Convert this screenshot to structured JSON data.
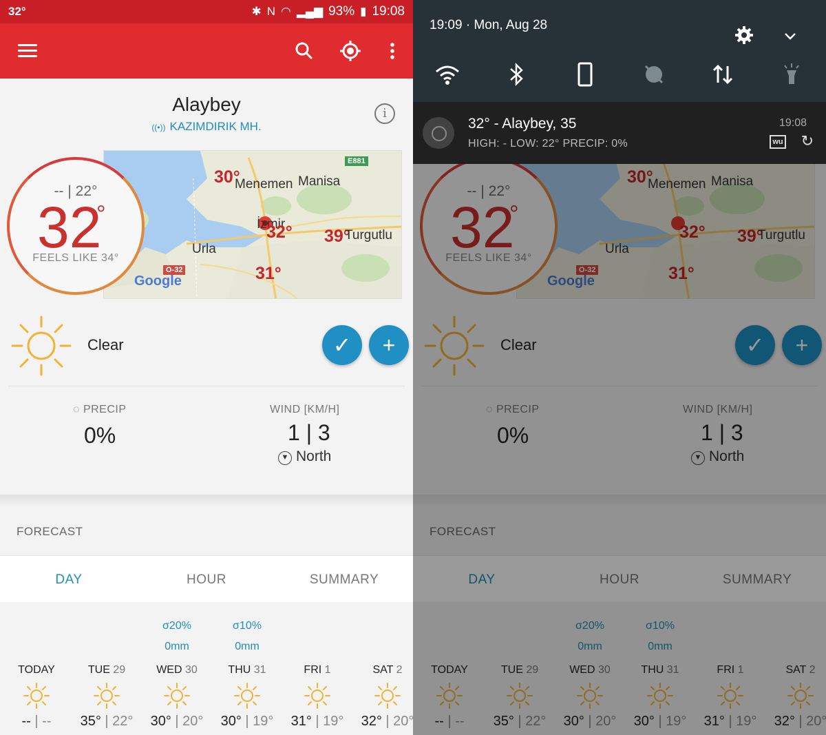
{
  "status": {
    "temp": "32°",
    "battery": "93%",
    "time": "19:08"
  },
  "location": {
    "name": "Alaybey",
    "station": "KAZIMDIRIK MH."
  },
  "current": {
    "hilo": "-- | 22°",
    "temp": "32",
    "deg": "°",
    "feels": "FEELS LIKE 34°",
    "condition": "Clear"
  },
  "map": {
    "labels": [
      "Menemen",
      "Manisa",
      "İzmir",
      "Turgutlu",
      "Urla"
    ],
    "temps": [
      "30°",
      "32°",
      "39°",
      "31°"
    ],
    "road_badges": [
      "E881",
      "O-32"
    ],
    "attribution": "Google"
  },
  "stats": {
    "precip_label": "PRECIP",
    "precip_value": "0%",
    "wind_label": "WIND [KM/H]",
    "wind_value": "1 | 3",
    "wind_dir": "North"
  },
  "forecast": {
    "title": "FORECAST",
    "tabs": [
      "DAY",
      "HOUR",
      "SUMMARY"
    ],
    "days": [
      {
        "pp": "",
        "mm": "",
        "name": "TODAY",
        "date": "",
        "hi": "--",
        "lo": "--"
      },
      {
        "pp": "",
        "mm": "",
        "name": "TUE",
        "date": "29",
        "hi": "35°",
        "lo": "22°"
      },
      {
        "pp": "20%",
        "mm": "0mm",
        "name": "WED",
        "date": "30",
        "hi": "30°",
        "lo": "20°"
      },
      {
        "pp": "10%",
        "mm": "0mm",
        "name": "THU",
        "date": "31",
        "hi": "30°",
        "lo": "19°"
      },
      {
        "pp": "",
        "mm": "",
        "name": "FRI",
        "date": "1",
        "hi": "31°",
        "lo": "19°"
      },
      {
        "pp": "",
        "mm": "",
        "name": "SAT",
        "date": "2",
        "hi": "32°",
        "lo": "20°"
      }
    ]
  },
  "shade": {
    "datetime": "19:09 · Mon, Aug 28"
  },
  "notification": {
    "title": "32° - Alaybey, 35",
    "subtitle": "HIGH: - LOW: 22° PRECIP: 0%",
    "time": "19:08",
    "app_badge": "wu"
  },
  "colors": {
    "app_bar": "#e02b2f",
    "accent": "#1f8fb5",
    "temp_red": "#c9302e",
    "shade": "#263238"
  }
}
